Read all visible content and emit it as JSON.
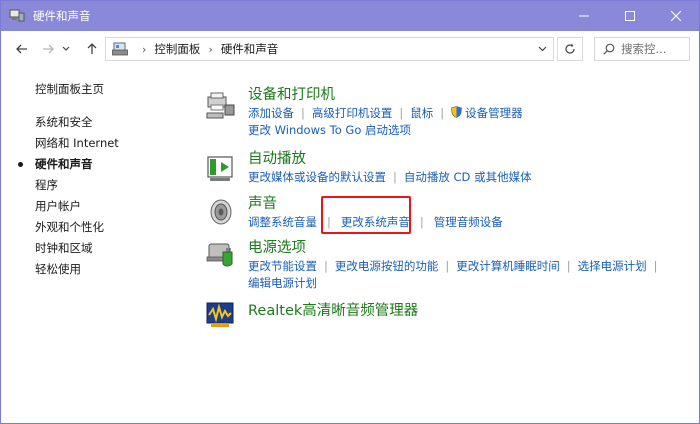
{
  "window": {
    "title": "硬件和声音"
  },
  "address": {
    "crumbs": [
      "控制面板",
      "硬件和声音"
    ]
  },
  "search": {
    "placeholder": "搜索控..."
  },
  "nav": {
    "home": "控制面板主页",
    "items": [
      "系统和安全",
      "网络和 Internet",
      "硬件和声音",
      "程序",
      "用户帐户",
      "外观和个性化",
      "时钟和区域",
      "轻松使用"
    ],
    "current_index": 2
  },
  "categories": {
    "devices": {
      "title": "设备和打印机",
      "links": [
        "添加设备",
        "高级打印机设置",
        "鼠标",
        "设备管理器",
        "更改 Windows To Go 启动选项"
      ]
    },
    "autoplay": {
      "title": "自动播放",
      "links": [
        "更改媒体或设备的默认设置",
        "自动播放 CD 或其他媒体"
      ]
    },
    "sound": {
      "title": "声音",
      "links": [
        "调整系统音量",
        "更改系统声音",
        "管理音频设备"
      ]
    },
    "power": {
      "title": "电源选项",
      "links": [
        "更改节能设置",
        "更改电源按钮的功能",
        "更改计算机睡眠时间",
        "选择电源计划",
        "编辑电源计划"
      ]
    },
    "realtek": {
      "title": "Realtek高清晰音频管理器"
    }
  },
  "colors": {
    "titlebar": "#8a88d8",
    "link": "#1a5fb4",
    "category_title": "#1c7a1c",
    "highlight": "#e8151a"
  }
}
